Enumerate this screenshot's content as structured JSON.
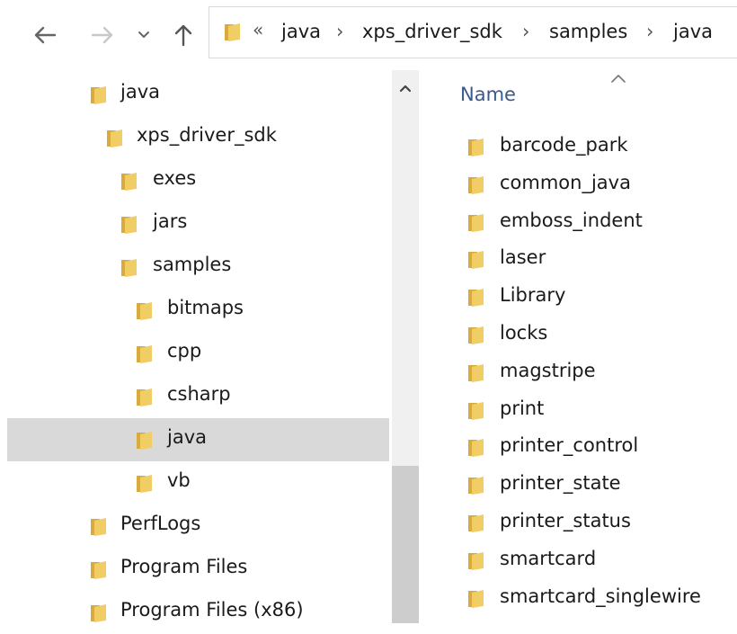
{
  "toolbar": {
    "back_icon": "arrow-left-icon",
    "forward_icon": "arrow-right-icon",
    "recent_icon": "chevron-down-icon",
    "up_icon": "arrow-up-icon"
  },
  "address_bar": {
    "overflow": "«",
    "crumbs": [
      "java",
      "xps_driver_sdk",
      "samples",
      "java"
    ],
    "separator": "›"
  },
  "colors": {
    "folder": "#e8c35a",
    "folder_dark": "#d9aa3c",
    "selection": "#d9d9d9",
    "header_text": "#3a5a8c"
  },
  "tree": [
    {
      "label": "java",
      "indent": 0
    },
    {
      "label": "xps_driver_sdk",
      "indent": 1
    },
    {
      "label": "exes",
      "indent": 2
    },
    {
      "label": "jars",
      "indent": 2
    },
    {
      "label": "samples",
      "indent": 2
    },
    {
      "label": "bitmaps",
      "indent": 3
    },
    {
      "label": "cpp",
      "indent": 3
    },
    {
      "label": "csharp",
      "indent": 3
    },
    {
      "label": "java",
      "indent": 3,
      "selected": true
    },
    {
      "label": "vb",
      "indent": 3
    },
    {
      "label": "PerfLogs",
      "indent": 0
    },
    {
      "label": "Program Files",
      "indent": 0
    },
    {
      "label": "Program Files (x86)",
      "indent": 0
    }
  ],
  "content": {
    "column_header": "Name",
    "files": [
      "barcode_park",
      "common_java",
      "emboss_indent",
      "laser",
      "Library",
      "locks",
      "magstripe",
      "print",
      "printer_control",
      "printer_state",
      "printer_status",
      "smartcard",
      "smartcard_singlewire"
    ]
  }
}
